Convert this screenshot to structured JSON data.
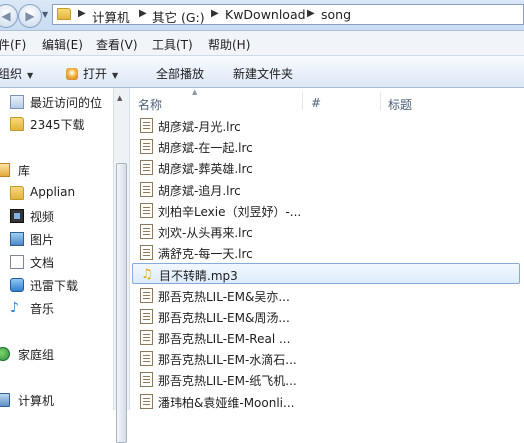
{
  "address": {
    "segments": [
      "计算机",
      "其它 (G:)",
      "KwDownload",
      "song"
    ]
  },
  "menu": [
    "件(F)",
    "编辑(E)",
    "查看(V)",
    "工具(T)",
    "帮助(H)"
  ],
  "toolbar": {
    "organize": "组织",
    "open": "打开",
    "play_all": "全部播放",
    "new_folder": "新建文件夹"
  },
  "nav": {
    "items": [
      {
        "label": "最近访问的位",
        "icon": "recent-places-icon"
      },
      {
        "label": "2345下载",
        "icon": "folder-icon"
      },
      {
        "label": "库",
        "icon": "library-icon"
      },
      {
        "label": "Applian",
        "icon": "folder-icon"
      },
      {
        "label": "视频",
        "icon": "video-icon"
      },
      {
        "label": "图片",
        "icon": "picture-icon"
      },
      {
        "label": "文档",
        "icon": "document-icon"
      },
      {
        "label": "迅雷下载",
        "icon": "xunlei-icon"
      },
      {
        "label": "音乐",
        "icon": "music-icon"
      },
      {
        "label": "家庭组",
        "icon": "homegroup-icon"
      },
      {
        "label": "计算机",
        "icon": "computer-icon"
      }
    ]
  },
  "columns": {
    "name": "名称",
    "num": "#",
    "title": "标题"
  },
  "files": [
    {
      "name": "胡彦斌-月光.lrc",
      "type": "lrc"
    },
    {
      "name": "胡彦斌-在一起.lrc",
      "type": "lrc"
    },
    {
      "name": "胡彦斌-葬英雄.lrc",
      "type": "lrc"
    },
    {
      "name": "胡彦斌-追月.lrc",
      "type": "lrc"
    },
    {
      "name": "刘柏辛Lexie（刘昱妤）-...",
      "type": "lrc"
    },
    {
      "name": "刘欢-从头再来.lrc",
      "type": "lrc"
    },
    {
      "name": "满舒克-每一天.lrc",
      "type": "lrc"
    },
    {
      "name": "目不转睛.mp3",
      "type": "mp3",
      "selected": true
    },
    {
      "name": "那吾克热LIL-EM&吴亦...",
      "type": "lrc"
    },
    {
      "name": "那吾克热LIL-EM&周汤...",
      "type": "lrc"
    },
    {
      "name": "那吾克热LIL-EM-Real ...",
      "type": "lrc"
    },
    {
      "name": "那吾克热LIL-EM-水滴石...",
      "type": "lrc"
    },
    {
      "name": "那吾克热LIL-EM-纸飞机...",
      "type": "lrc"
    },
    {
      "name": "潘玮柏&袁娅维-Moonli...",
      "type": "lrc"
    }
  ]
}
